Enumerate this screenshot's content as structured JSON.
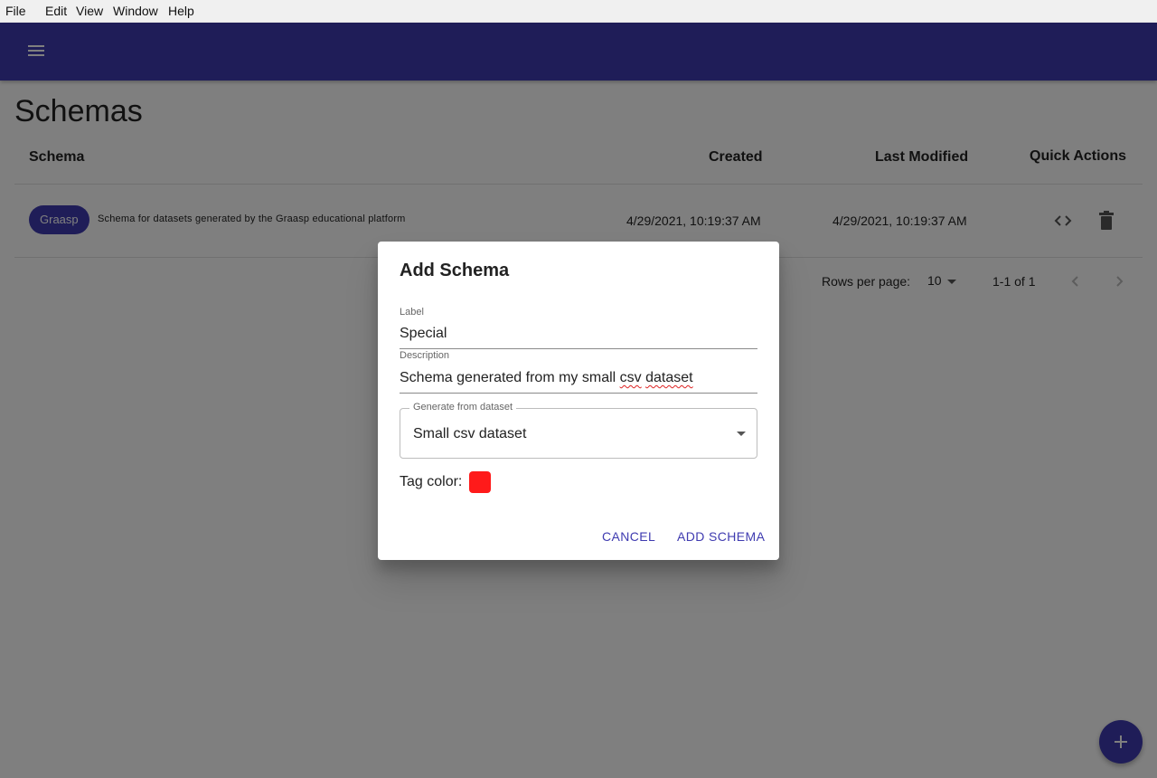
{
  "menubar": {
    "items": [
      "File",
      "Edit",
      "View",
      "Window",
      "Help"
    ]
  },
  "appbar": {
    "menu_icon": "hamburger-icon",
    "color": "#3f3bb0"
  },
  "page": {
    "title": "Schemas"
  },
  "table": {
    "headers": [
      "Schema",
      "Created",
      "Last Modified",
      "Quick Actions"
    ],
    "rows": [
      {
        "tag": "Graasp",
        "tag_color": "#3f3bb0",
        "description": "Schema for datasets generated by the Graasp educational platform",
        "created": "4/29/2021, 10:19:37 AM",
        "last_modified": "4/29/2021, 10:19:37 AM",
        "actions": [
          "code-icon",
          "delete-icon"
        ]
      }
    ]
  },
  "pagination": {
    "rows_per_page_label": "Rows per page:",
    "rows_per_page_value": "10",
    "range": "1-1 of 1"
  },
  "fab": {
    "icon": "plus-icon"
  },
  "dialog": {
    "title": "Add Schema",
    "label_field": {
      "label": "Label",
      "value": "Special"
    },
    "description_field": {
      "label": "Description",
      "value_prefix": "Schema generated from my small ",
      "value_misspelled_1": "csv",
      "value_space": " ",
      "value_misspelled_2": "dataset"
    },
    "dataset_select": {
      "label": "Generate from dataset",
      "value": "Small csv dataset"
    },
    "tag_color": {
      "label": "Tag color:",
      "color": "#ff1a1a"
    },
    "cancel_label": "CANCEL",
    "add_label": "ADD SCHEMA"
  }
}
